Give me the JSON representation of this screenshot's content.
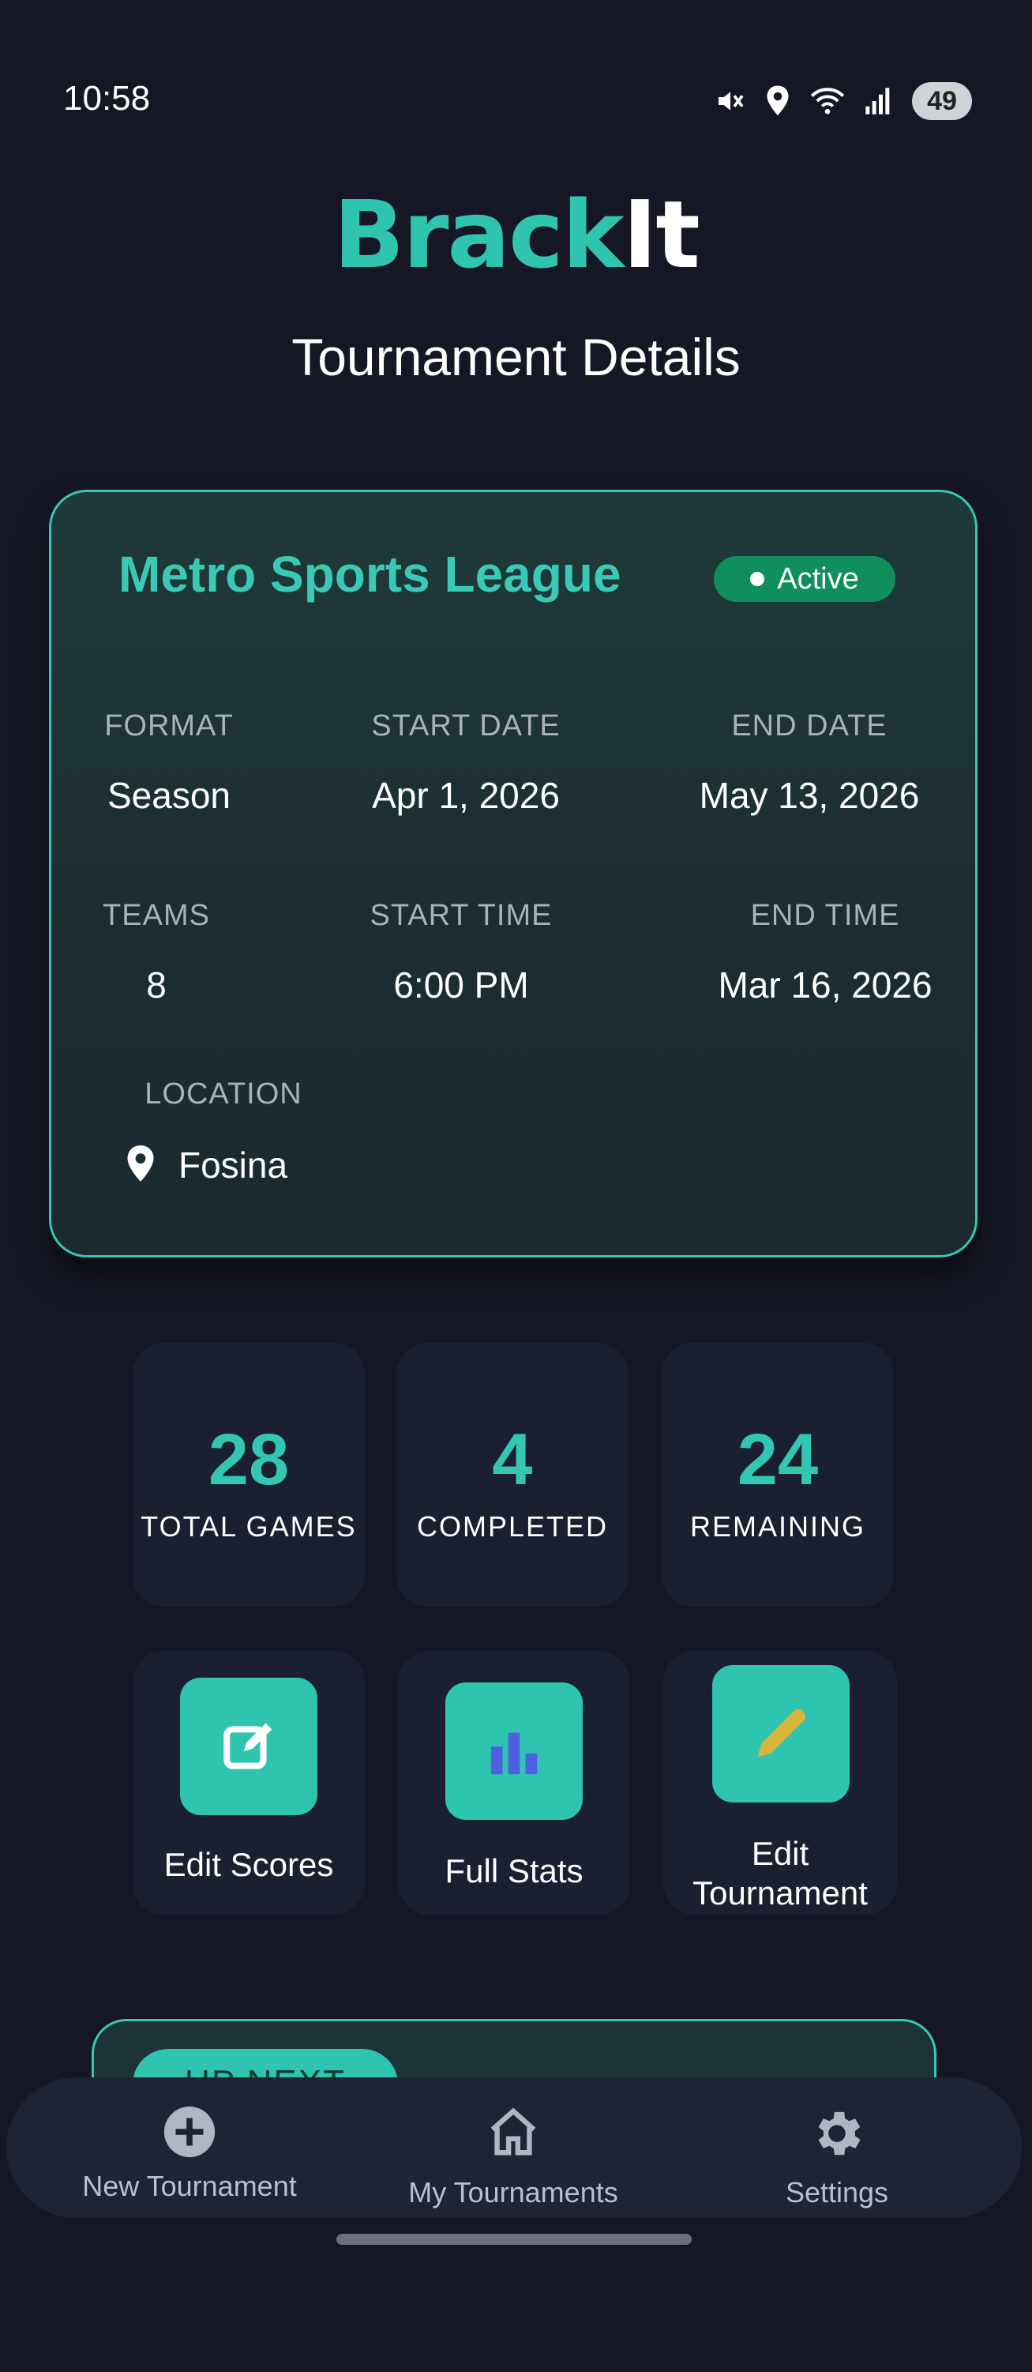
{
  "status_bar": {
    "time": "10:58",
    "battery": "49",
    "icons": [
      "mute-icon",
      "location-icon",
      "wifi-icon",
      "signal-icon",
      "battery-icon"
    ]
  },
  "app": {
    "logo_part1": "Brack",
    "logo_part2": "It",
    "page_title": "Tournament Details"
  },
  "tournament": {
    "name": "Metro Sports League",
    "status": "Active",
    "format_label": "FORMAT",
    "format": "Season",
    "start_date_label": "START DATE",
    "start_date": "Apr 1, 2026",
    "end_date_label": "END DATE",
    "end_date": "May 13, 2026",
    "teams_label": "TEAMS",
    "teams": "8",
    "start_time_label": "START TIME",
    "start_time": "6:00 PM",
    "end_time_label": "END TIME",
    "end_time": "Mar 16, 2026",
    "location_label": "LOCATION",
    "location": "Fosina"
  },
  "stats": [
    {
      "value": "28",
      "label": "TOTAL GAMES"
    },
    {
      "value": "4",
      "label": "COMPLETED"
    },
    {
      "value": "24",
      "label": "REMAINING"
    }
  ],
  "actions": {
    "edit_scores": "Edit Scores",
    "full_stats": "Full Stats",
    "edit_tournament_line1": "Edit",
    "edit_tournament_line2": "Tournament"
  },
  "up_next": {
    "label": "UP NEXT"
  },
  "nav": {
    "new_tournament": "New Tournament",
    "my_tournaments": "My Tournaments",
    "settings": "Settings"
  },
  "colors": {
    "accent": "#2ec4b0",
    "background": "#151824",
    "active_badge": "#0f8e5e",
    "stats_icon": "#4f5fe0",
    "pencil_icon": "#d9b43a"
  }
}
